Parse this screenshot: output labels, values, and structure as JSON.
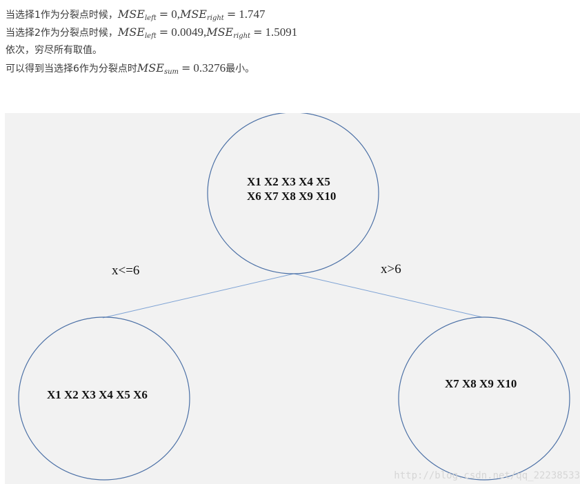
{
  "text": {
    "line1": {
      "prefix": "当选择1作为分裂点时候，",
      "mse1_label": "MSE",
      "mse1_sub": "left",
      "eq1": "=",
      "val1": "0,",
      "mse2_label": "MSE",
      "mse2_sub": "right",
      "eq2": "=",
      "val2": "1.747"
    },
    "line2": {
      "prefix": "当选择2作为分裂点时候，",
      "mse1_label": "MSE",
      "mse1_sub": "left",
      "eq1": "=",
      "val1": "0.0049,",
      "mse2_label": "MSE",
      "mse2_sub": "right",
      "eq2": "=",
      "val2": "1.5091"
    },
    "line3": "依次，穷尽所有取值。",
    "line4": {
      "prefix": "可以得到当选择6作为分裂点时",
      "mse_label": "MSE",
      "mse_sub": "sum",
      "eq": "=",
      "val": "0.3276",
      "suffix": "最小。"
    }
  },
  "diagram": {
    "root": {
      "line1": "X1 X2 X3 X4 X5",
      "line2": "X6 X7 X8 X9 X10"
    },
    "left_child": {
      "line1": "X1 X2 X3 X4 X5 X6"
    },
    "right_child": {
      "line1": "X7 X8 X9 X10"
    },
    "left_edge_label": "x<=6",
    "right_edge_label": "x>6",
    "colors": {
      "circle_stroke": "#4a6fa5",
      "edge_stroke": "#7da2d4",
      "background": "#f2f2f2"
    }
  },
  "watermark": "http://blog.csdn.net/qq_22238533"
}
